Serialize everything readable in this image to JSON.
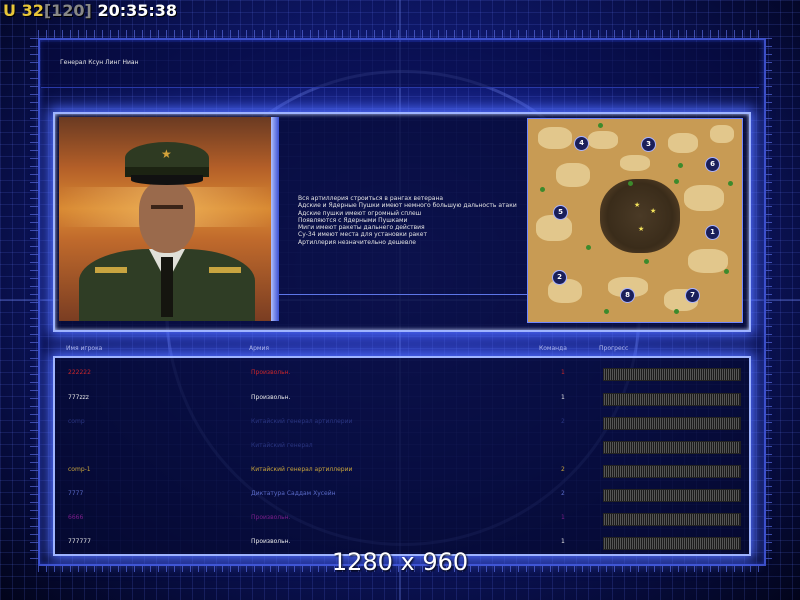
{
  "hud": {
    "u_label": "U",
    "fps": "32",
    "fps_max": "[120]",
    "clock": "20:35:38"
  },
  "general_title": "Генерал Ксун Линг Ниан",
  "description_lines": [
    "Вся артиллерия строиться в рангах ветерана",
    "Адские и Ядерные Пушки имеют немного большую дальность атаки",
    "Адские пушки имеют огромный сплеш",
    "Появляются с Ядерными Пушками",
    "Миги имеют ракеты дальнего действия",
    "Су-34 имеют места для установки ракет",
    "Артиллерия незначительно дешевле"
  ],
  "columns": {
    "name": "Имя игрока",
    "army": "Армия",
    "team": "Команда",
    "progress": "Прогресс"
  },
  "players": [
    {
      "name": "222222",
      "army": "Произвольн.",
      "team": "1",
      "color": "#c8262a"
    },
    {
      "name": "777zzz",
      "army": "Произвольн.",
      "team": "1",
      "color": "#e8e8e8"
    },
    {
      "name": "comp",
      "army": "Китайский генерал артиллерии",
      "team": "2",
      "color": "#1f2a6a"
    },
    {
      "name": "",
      "army": "Китайский генерал",
      "team": "",
      "color": "#1f2a6a"
    },
    {
      "name": "comp-1",
      "army": "Китайский генерал артиллерии",
      "team": "2",
      "color": "#c8a43a"
    },
    {
      "name": "7777",
      "army": "Диктатура Саддам Хусейн",
      "team": "2",
      "color": "#5a6ac8"
    },
    {
      "name": "6666",
      "army": "Произвольн.",
      "team": "1",
      "color": "#7a1e8a"
    },
    {
      "name": "777777",
      "army": "Произвольн.",
      "team": "1",
      "color": "#e8e8e8"
    }
  ],
  "map_spawns": [
    "1",
    "2",
    "3",
    "4",
    "5",
    "6",
    "7",
    "8"
  ],
  "watermark": "1280 x 960",
  "colors": {
    "accent": "#9fb4ff",
    "background": "#101a72"
  }
}
